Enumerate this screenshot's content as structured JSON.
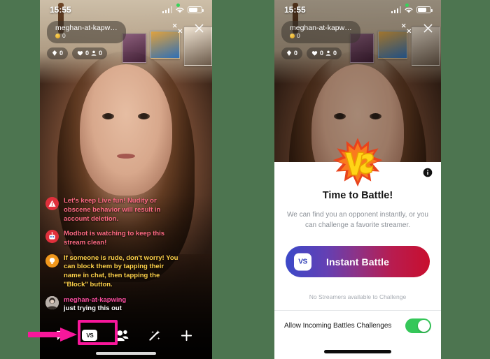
{
  "background_color": "#4d7550",
  "left_phone": {
    "status_bar": {
      "time": "15:55",
      "signal_icon": "signal-bars-icon",
      "wifi_icon": "wifi-icon",
      "battery_icon": "battery-icon"
    },
    "header": {
      "username": "meghan-at-kapw…",
      "coin_count": "0",
      "collapse_icon": "collapse-arrows-icon",
      "close_icon": "close-x-icon",
      "badges": [
        {
          "icon": "diamond-icon",
          "value": "0"
        },
        {
          "icon": "heart-icon",
          "value": "0",
          "icon2": "viewers-icon",
          "value2": "0"
        }
      ]
    },
    "chat": [
      {
        "avatar": "warning-triangle-icon",
        "style": "moderation",
        "text": "Let's keep Live fun! Nudity or obscene behavior will result in account deletion."
      },
      {
        "avatar": "robot-icon",
        "style": "bot",
        "text": "Modbot is watching to keep this stream clean!"
      },
      {
        "avatar": "lightbulb-icon",
        "style": "tip",
        "text": "If someone is rude, don't worry! You can block them by tapping their name in chat, then tapping the \"Block\" button."
      },
      {
        "avatar": "user-avatar-icon",
        "style": "user",
        "name": "meghan-at-kapwing",
        "text": "just trying this out"
      }
    ],
    "toolbar": [
      {
        "name": "chat-bubble-icon",
        "label": ""
      },
      {
        "name": "vs-battle-button",
        "label": "VS"
      },
      {
        "name": "guests-icon",
        "label": ""
      },
      {
        "name": "effects-wand-icon",
        "label": ""
      },
      {
        "name": "add-plus-icon",
        "label": ""
      }
    ],
    "annotation": {
      "highlight_color": "#f8179b",
      "arrow_icon": "pink-arrow-icon"
    }
  },
  "right_phone": {
    "status_bar": {
      "time": "15:55",
      "signal_icon": "signal-bars-icon",
      "wifi_icon": "wifi-icon",
      "battery_icon": "battery-icon"
    },
    "header": {
      "username": "meghan-at-kapw…",
      "coin_count": "0",
      "collapse_icon": "collapse-arrows-icon",
      "close_icon": "close-x-icon",
      "badges": [
        {
          "icon": "diamond-icon",
          "value": "0"
        },
        {
          "icon": "heart-icon",
          "value": "0",
          "icon2": "viewers-icon",
          "value2": "0"
        }
      ]
    },
    "battle_sheet": {
      "burst_icon": "vs-starburst-icon",
      "info_icon": "info-circle-icon",
      "title": "Time to Battle!",
      "subtitle": "We can find you an opponent instantly, or you can challenge a favorite streamer.",
      "instant_battle_label": "Instant Battle",
      "instant_battle_badge": "VS",
      "gradient_start": "#3b49c8",
      "gradient_end": "#c80f2e",
      "no_streamers_text": "No Streamers available to Challenge",
      "toggle_label": "Allow Incoming Battles Challenges",
      "toggle_state": "on",
      "toggle_color": "#35c759"
    }
  }
}
